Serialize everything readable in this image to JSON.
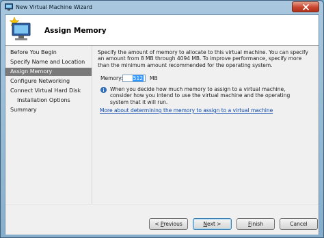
{
  "window": {
    "title": "New Virtual Machine Wizard"
  },
  "header": {
    "title": "Assign Memory"
  },
  "nav": {
    "items": [
      {
        "label": "Before You Begin",
        "active": false,
        "sub": false
      },
      {
        "label": "Specify Name and Location",
        "active": false,
        "sub": false
      },
      {
        "label": "Assign Memory",
        "active": true,
        "sub": false
      },
      {
        "label": "Configure Networking",
        "active": false,
        "sub": false
      },
      {
        "label": "Connect Virtual Hard Disk",
        "active": false,
        "sub": false
      },
      {
        "label": "Installation Options",
        "active": false,
        "sub": true
      },
      {
        "label": "Summary",
        "active": false,
        "sub": false
      }
    ]
  },
  "content": {
    "description": "Specify the amount of memory to allocate to this virtual machine. You can specify an amount from 8 MB through 4094 MB. To improve performance, specify more than the minimum amount recommended for the operating system.",
    "memory_label": "Memory:",
    "memory_value": "512",
    "memory_unit": "MB",
    "info_text": "When you decide how much memory to assign to a virtual machine, consider how you intend to use the virtual machine and the operating system that it will run.",
    "more_link": "More about determining the memory to assign to a virtual machine"
  },
  "buttons": {
    "previous": {
      "prefix": "< ",
      "key": "P",
      "rest": "revious"
    },
    "next": {
      "key": "N",
      "rest": "ext >"
    },
    "finish": {
      "key": "F",
      "rest": "inish"
    },
    "cancel": "Cancel"
  },
  "colors": {
    "accent": "#6fa3c9",
    "nav_active": "#7a7a7a",
    "link": "#0645ad"
  },
  "icons": {
    "window": "vm-wizard-icon",
    "header": "computer-star-icon",
    "info": "info-icon",
    "close": "close-icon"
  }
}
